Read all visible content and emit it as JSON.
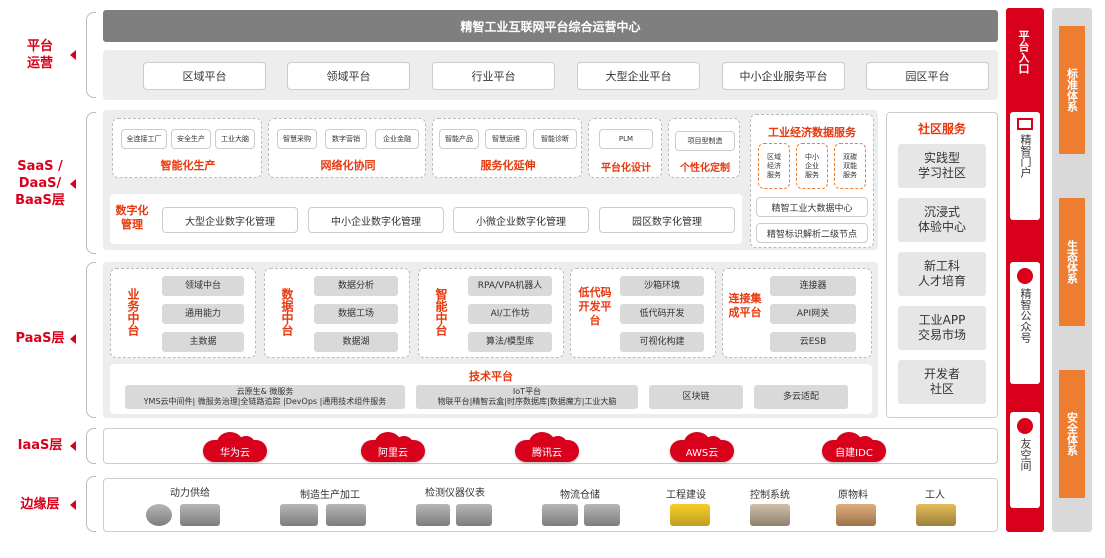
{
  "layers": {
    "platform": "平台\n运营",
    "saas": "SaaS /\nDaaS/\nBaaS层",
    "paas": "PaaS层",
    "iaas": "IaaS层",
    "edge": "边缘层"
  },
  "top_bar": "精智工业互联网平台综合运营中心",
  "platform_items": [
    "区域平台",
    "领域平台",
    "行业平台",
    "大型企业平台",
    "中小企业服务平台",
    "园区平台"
  ],
  "saas": {
    "groups": [
      {
        "items": [
          "全连接工厂",
          "安全生产",
          "工业大脑"
        ],
        "title": "智能化生产"
      },
      {
        "items": [
          "智慧采购",
          "数字营销",
          "企业金融"
        ],
        "title": "网络化协同"
      },
      {
        "items": [
          "智能产品",
          "智慧运维",
          "智能诊断"
        ],
        "title": "服务化延伸"
      },
      {
        "items": [
          "PLM"
        ],
        "title": "平台化设计"
      },
      {
        "items": [
          "项目型制造"
        ],
        "title": "个性化定制"
      }
    ],
    "digital_label": "数字化\n管理",
    "digital_items": [
      "大型企业数字化管理",
      "中小企业数字化管理",
      "小微企业数字化管理",
      "园区数字化管理"
    ],
    "econ": {
      "title": "工业经济数据服务",
      "items": [
        "区域\n经济\n服务",
        "中小\n企业\n服务",
        "双碳\n双能\n服务"
      ],
      "rows": [
        "精智工业大数据中心",
        "精智标识解析二级节点"
      ]
    }
  },
  "community": {
    "title": "社区服务",
    "items": [
      "实践型\n学习社区",
      "沉浸式\n体验中心",
      "新工科\n人才培育",
      "工业APP\n交易市场",
      "开发者\n社区"
    ]
  },
  "paas": {
    "groups": [
      {
        "title": "业务中台",
        "items": [
          "领域中台",
          "通用能力",
          "主数据"
        ]
      },
      {
        "title": "数据中台",
        "items": [
          "数据分析",
          "数据工场",
          "数据湖"
        ]
      },
      {
        "title": "智能中台",
        "items": [
          "RPA/VPA机器人",
          "AI/工作坊",
          "算法/模型库"
        ]
      },
      {
        "title": "低代码开发平台",
        "items": [
          "沙箱环境",
          "低代码开发",
          "可视化构建"
        ]
      },
      {
        "title": "连接集成平台",
        "items": [
          "连接器",
          "API网关",
          "云ESB"
        ]
      }
    ],
    "tech": {
      "title": "技术平台",
      "items": [
        "云原生& 微服务\nYMS云中间件| 微服务治理|全链路追踪 |DevOps |通用技术组件服务",
        "IoT平台\n物联平台|精智云盒|时序数据库|数据魔方|工业大脑",
        "区块链",
        "多云适配"
      ]
    }
  },
  "iaas_clouds": [
    "华为云",
    "阿里云",
    "腾讯云",
    "AWS云",
    "自建IDC"
  ],
  "edge_items": [
    "动力供给",
    "制造生产加工",
    "检测仪器仪表",
    "物流仓储",
    "工程建设",
    "控制系统",
    "原物料",
    "工人"
  ],
  "right_entry": {
    "title": "平台入口",
    "portals": [
      "精智门户",
      "精智公众号",
      "友空间"
    ]
  },
  "systems": [
    "标准体系",
    "生态体系",
    "安全体系"
  ],
  "colors": {
    "accent_red": "#d9001b",
    "orange": "#ed7d31",
    "highlight": "#e8380d",
    "top_bar": "#7f7f7f"
  }
}
